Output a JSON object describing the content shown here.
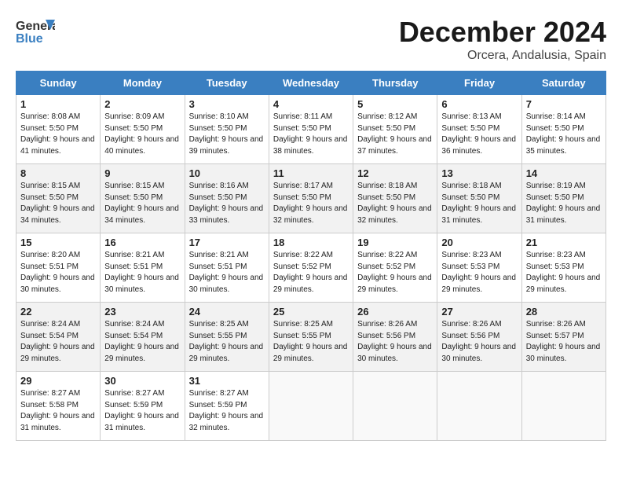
{
  "header": {
    "logo_general": "General",
    "logo_blue": "Blue",
    "month_year": "December 2024",
    "location": "Orcera, Andalusia, Spain"
  },
  "weekdays": [
    "Sunday",
    "Monday",
    "Tuesday",
    "Wednesday",
    "Thursday",
    "Friday",
    "Saturday"
  ],
  "weeks": [
    [
      {
        "day": "1",
        "sunrise": "Sunrise: 8:08 AM",
        "sunset": "Sunset: 5:50 PM",
        "daylight": "Daylight: 9 hours and 41 minutes."
      },
      {
        "day": "2",
        "sunrise": "Sunrise: 8:09 AM",
        "sunset": "Sunset: 5:50 PM",
        "daylight": "Daylight: 9 hours and 40 minutes."
      },
      {
        "day": "3",
        "sunrise": "Sunrise: 8:10 AM",
        "sunset": "Sunset: 5:50 PM",
        "daylight": "Daylight: 9 hours and 39 minutes."
      },
      {
        "day": "4",
        "sunrise": "Sunrise: 8:11 AM",
        "sunset": "Sunset: 5:50 PM",
        "daylight": "Daylight: 9 hours and 38 minutes."
      },
      {
        "day": "5",
        "sunrise": "Sunrise: 8:12 AM",
        "sunset": "Sunset: 5:50 PM",
        "daylight": "Daylight: 9 hours and 37 minutes."
      },
      {
        "day": "6",
        "sunrise": "Sunrise: 8:13 AM",
        "sunset": "Sunset: 5:50 PM",
        "daylight": "Daylight: 9 hours and 36 minutes."
      },
      {
        "day": "7",
        "sunrise": "Sunrise: 8:14 AM",
        "sunset": "Sunset: 5:50 PM",
        "daylight": "Daylight: 9 hours and 35 minutes."
      }
    ],
    [
      {
        "day": "8",
        "sunrise": "Sunrise: 8:15 AM",
        "sunset": "Sunset: 5:50 PM",
        "daylight": "Daylight: 9 hours and 34 minutes."
      },
      {
        "day": "9",
        "sunrise": "Sunrise: 8:15 AM",
        "sunset": "Sunset: 5:50 PM",
        "daylight": "Daylight: 9 hours and 34 minutes."
      },
      {
        "day": "10",
        "sunrise": "Sunrise: 8:16 AM",
        "sunset": "Sunset: 5:50 PM",
        "daylight": "Daylight: 9 hours and 33 minutes."
      },
      {
        "day": "11",
        "sunrise": "Sunrise: 8:17 AM",
        "sunset": "Sunset: 5:50 PM",
        "daylight": "Daylight: 9 hours and 32 minutes."
      },
      {
        "day": "12",
        "sunrise": "Sunrise: 8:18 AM",
        "sunset": "Sunset: 5:50 PM",
        "daylight": "Daylight: 9 hours and 32 minutes."
      },
      {
        "day": "13",
        "sunrise": "Sunrise: 8:18 AM",
        "sunset": "Sunset: 5:50 PM",
        "daylight": "Daylight: 9 hours and 31 minutes."
      },
      {
        "day": "14",
        "sunrise": "Sunrise: 8:19 AM",
        "sunset": "Sunset: 5:50 PM",
        "daylight": "Daylight: 9 hours and 31 minutes."
      }
    ],
    [
      {
        "day": "15",
        "sunrise": "Sunrise: 8:20 AM",
        "sunset": "Sunset: 5:51 PM",
        "daylight": "Daylight: 9 hours and 30 minutes."
      },
      {
        "day": "16",
        "sunrise": "Sunrise: 8:21 AM",
        "sunset": "Sunset: 5:51 PM",
        "daylight": "Daylight: 9 hours and 30 minutes."
      },
      {
        "day": "17",
        "sunrise": "Sunrise: 8:21 AM",
        "sunset": "Sunset: 5:51 PM",
        "daylight": "Daylight: 9 hours and 30 minutes."
      },
      {
        "day": "18",
        "sunrise": "Sunrise: 8:22 AM",
        "sunset": "Sunset: 5:52 PM",
        "daylight": "Daylight: 9 hours and 29 minutes."
      },
      {
        "day": "19",
        "sunrise": "Sunrise: 8:22 AM",
        "sunset": "Sunset: 5:52 PM",
        "daylight": "Daylight: 9 hours and 29 minutes."
      },
      {
        "day": "20",
        "sunrise": "Sunrise: 8:23 AM",
        "sunset": "Sunset: 5:53 PM",
        "daylight": "Daylight: 9 hours and 29 minutes."
      },
      {
        "day": "21",
        "sunrise": "Sunrise: 8:23 AM",
        "sunset": "Sunset: 5:53 PM",
        "daylight": "Daylight: 9 hours and 29 minutes."
      }
    ],
    [
      {
        "day": "22",
        "sunrise": "Sunrise: 8:24 AM",
        "sunset": "Sunset: 5:54 PM",
        "daylight": "Daylight: 9 hours and 29 minutes."
      },
      {
        "day": "23",
        "sunrise": "Sunrise: 8:24 AM",
        "sunset": "Sunset: 5:54 PM",
        "daylight": "Daylight: 9 hours and 29 minutes."
      },
      {
        "day": "24",
        "sunrise": "Sunrise: 8:25 AM",
        "sunset": "Sunset: 5:55 PM",
        "daylight": "Daylight: 9 hours and 29 minutes."
      },
      {
        "day": "25",
        "sunrise": "Sunrise: 8:25 AM",
        "sunset": "Sunset: 5:55 PM",
        "daylight": "Daylight: 9 hours and 29 minutes."
      },
      {
        "day": "26",
        "sunrise": "Sunrise: 8:26 AM",
        "sunset": "Sunset: 5:56 PM",
        "daylight": "Daylight: 9 hours and 30 minutes."
      },
      {
        "day": "27",
        "sunrise": "Sunrise: 8:26 AM",
        "sunset": "Sunset: 5:56 PM",
        "daylight": "Daylight: 9 hours and 30 minutes."
      },
      {
        "day": "28",
        "sunrise": "Sunrise: 8:26 AM",
        "sunset": "Sunset: 5:57 PM",
        "daylight": "Daylight: 9 hours and 30 minutes."
      }
    ],
    [
      {
        "day": "29",
        "sunrise": "Sunrise: 8:27 AM",
        "sunset": "Sunset: 5:58 PM",
        "daylight": "Daylight: 9 hours and 31 minutes."
      },
      {
        "day": "30",
        "sunrise": "Sunrise: 8:27 AM",
        "sunset": "Sunset: 5:59 PM",
        "daylight": "Daylight: 9 hours and 31 minutes."
      },
      {
        "day": "31",
        "sunrise": "Sunrise: 8:27 AM",
        "sunset": "Sunset: 5:59 PM",
        "daylight": "Daylight: 9 hours and 32 minutes."
      },
      null,
      null,
      null,
      null
    ]
  ]
}
